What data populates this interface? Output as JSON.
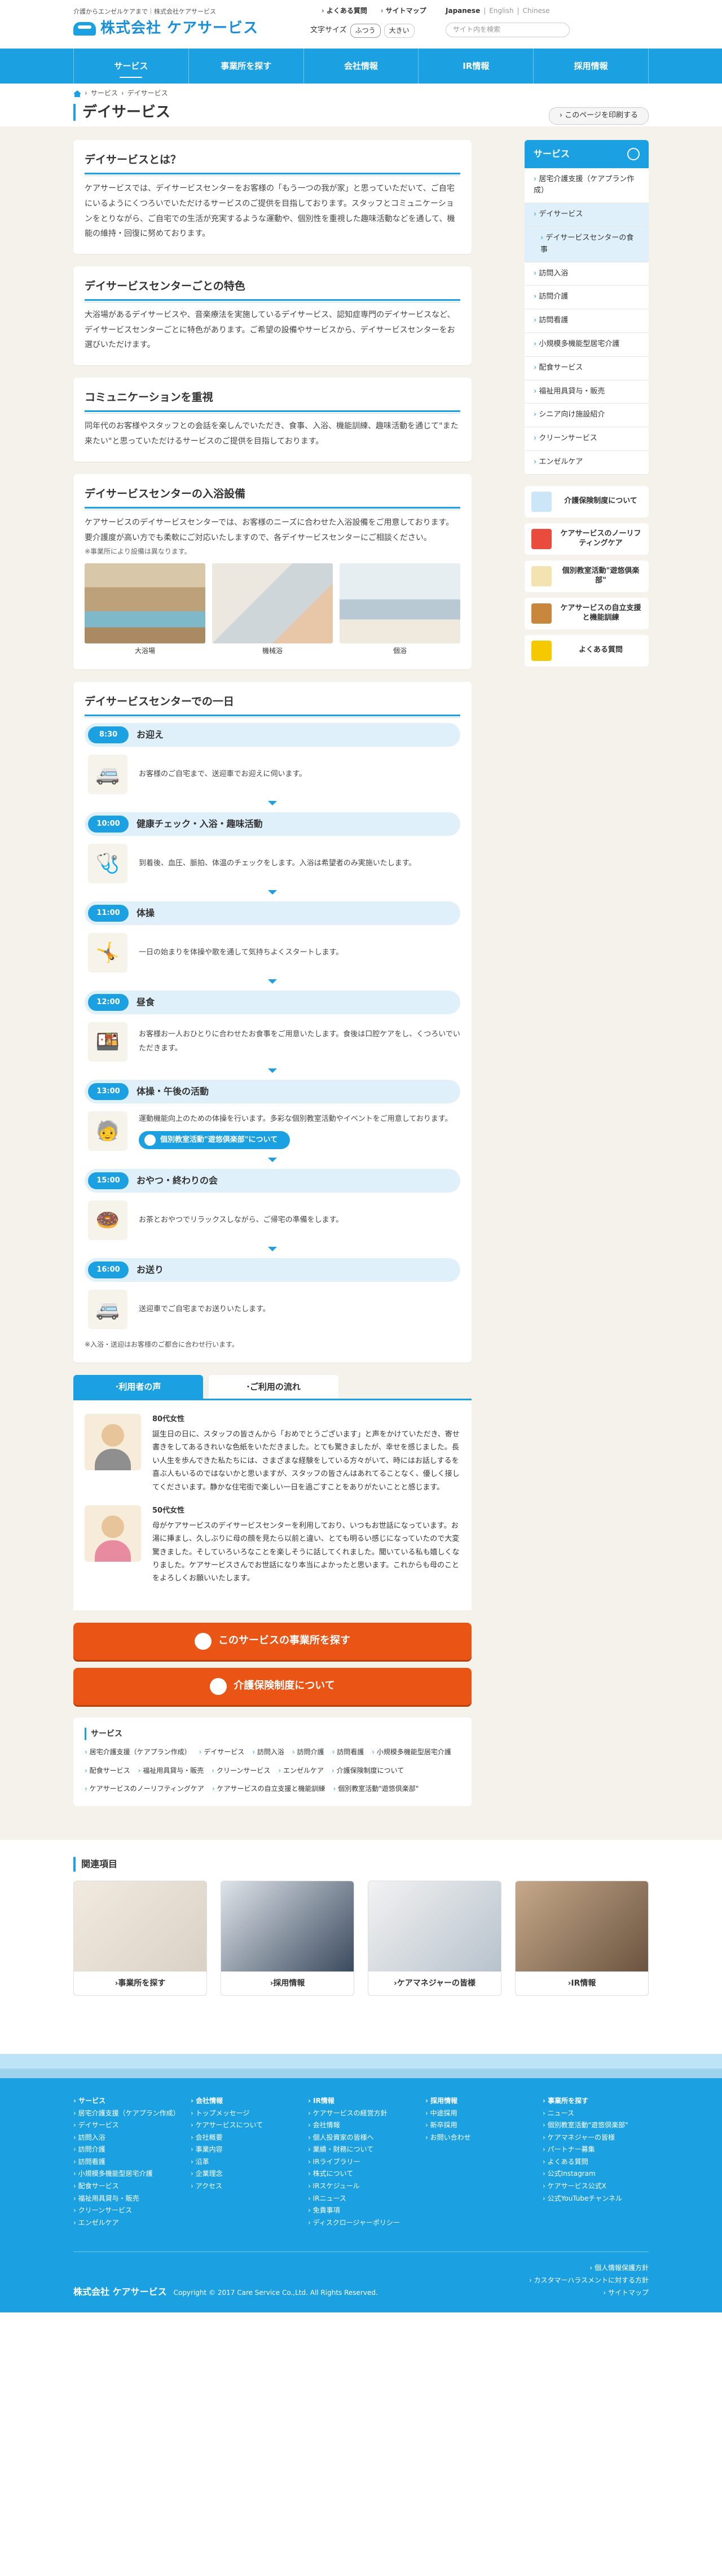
{
  "header": {
    "tagline": "介護からエンゼルケアまで｜株式会社ケアサービス",
    "logo": "株式会社 ケアサービス",
    "faq": "よくある質問",
    "sitemap": "サイトマップ",
    "langs": [
      "Japanese",
      "English",
      "Chinese"
    ],
    "fontsize_label": "文字サイズ",
    "fontsize_normal": "ふつう",
    "fontsize_large": "大きい",
    "search_placeholder": "サイト内を検索"
  },
  "gnav": [
    "サービス",
    "事業所を探す",
    "会社情報",
    "IR情報",
    "採用情報"
  ],
  "breadcrumb": [
    "サービス",
    "デイサービス"
  ],
  "page_title": "デイサービス",
  "print_label": "このページを印刷する",
  "sections": {
    "about": {
      "title": "デイサービスとは？",
      "text": "ケアサービスでは、デイサービスセンターをお客様の「もう一つの我が家」と思っていただいて、ご自宅にいるようにくつろいでいただけるサービスのご提供を目指しております。スタッフとコミュニケーションをとりながら、ご自宅での生活が充実するような運動や、個別性を重視した趣味活動などを通して、機能の維持・回復に努めております。"
    },
    "features": {
      "title": "デイサービスセンターごとの特色",
      "text": "大浴場があるデイサービスや、音楽療法を実施しているデイサービス、認知症専門のデイサービスなど、デイサービスセンターごとに特色があります。ご希望の設備やサービスから、デイサービスセンターをお選びいただけます。"
    },
    "communication": {
      "title": "コミュニケーションを重視",
      "text": "同年代のお客様やスタッフとの会話を楽しんでいただき、食事、入浴、機能訓練、趣味活動を通じて\"また来たい\"と思っていただけるサービスのご提供を目指しております。"
    },
    "bath": {
      "title": "デイサービスセンターの入浴設備",
      "text": "ケアサービスのデイサービスセンターでは、お客様のニーズに合わせた入浴設備をご用意しております。要介護度が高い方でも柔軟にご対応いたしますので、各デイサービスセンターにご相談ください。",
      "note": "※事業所により設備は異なります。",
      "photos": [
        "大浴場",
        "機械浴",
        "個浴"
      ]
    },
    "day": {
      "title": "デイサービスセンターでの一日",
      "steps": [
        {
          "time": "8:30",
          "title": "お迎え",
          "text": "お客様のご自宅まで、送迎車でお迎えに伺います。",
          "icon": "car-icon"
        },
        {
          "time": "10:00",
          "title": "健康チェック・入浴・趣味活動",
          "text": "到着後、血圧、脈拍、体温のチェックをします。入浴は希望者のみ実施いたします。",
          "icon": "stethoscope-icon"
        },
        {
          "time": "11:00",
          "title": "体操",
          "text": "一日の始まりを体操や歌を通して気持ちよくスタートします。",
          "icon": "exercise-icon"
        },
        {
          "time": "12:00",
          "title": "昼食",
          "text": "お客様お一人おひとりに合わせたお食事をご用意いたします。食後は口腔ケアをし、くつろいでいただきます。",
          "icon": "meal-icon"
        },
        {
          "time": "13:00",
          "title": "体操・午後の活動",
          "text": "運動機能向上のための体操を行います。多彩な個別教室活動やイベントをご用意しております。",
          "icon": "activity-icon",
          "button": "個別教室活動\"遊悠倶楽部\"について"
        },
        {
          "time": "15:00",
          "title": "おやつ・終わりの会",
          "text": "お茶とおやつでリラックスしながら、ご帰宅の準備をします。",
          "icon": "snack-icon"
        },
        {
          "time": "16:00",
          "title": "お送り",
          "text": "送迎車でご自宅までお送りいたします。",
          "icon": "car-icon"
        }
      ],
      "note": "※入浴・送迎はお客様のご都合に合わせ行います。"
    }
  },
  "tabs": [
    "利用者の声",
    "ご利用の流れ"
  ],
  "voices": [
    {
      "who": "80代女性",
      "text": "誕生日の日に、スタッフの皆さんから「おめでとうございます」と声をかけていただき、寄せ書きをしてあるきれいな色紙をいただきました。とても驚きましたが、幸せを感じました。長い人生を歩んできた私たちには、さまざまな経験をしている方々がいて、時にはお話しするを喜ぶ人もいるのではないかと思いますが、スタッフの皆さんはあれてることなく、優しく接してくださいます。静かな住宅街で楽しい一日を過ごすことをありがたいことと感じます。"
    },
    {
      "who": "50代女性",
      "text": "母がケアサービスのデイサービスセンターを利用しており、いつもお世話になっています。お湯に挿まし、久しぶりに母の顔を見たら以前と違い、とても明るい感じになっていたので大変驚きました。そしていろいろなことを楽しそうに話してくれました。聞いている私も嬉しくなりました。ケアサービスさんでお世話になり本当によかったと思います。これからも母のことをよろしくお願いいたします。"
    }
  ],
  "buttons": {
    "find": "このサービスの事業所を探す",
    "insurance": "介護保険制度について"
  },
  "service_links": {
    "title": "サービス",
    "items": [
      "居宅介護支援（ケアプラン作成）",
      "デイサービス",
      "訪問入浴",
      "訪問介護",
      "訪問看護",
      "小規模多機能型居宅介護",
      "配食サービス",
      "福祉用具貸与・販売",
      "クリーンサービス",
      "エンゼルケア",
      "介護保険制度について",
      "ケアサービスのノーリフティングケア",
      "ケアサービスの自立支援と機能訓練",
      "個別教室活動\"遊悠倶楽部\""
    ]
  },
  "side": {
    "title": "サービス",
    "items": [
      "居宅介護支援（ケアプラン作成）",
      "デイサービス",
      "デイサービスセンターの食事",
      "訪問入浴",
      "訪問介護",
      "訪問看護",
      "小規模多機能型居宅介護",
      "配食サービス",
      "福祉用具貸与・販売",
      "シニア向け施設紹介",
      "クリーンサービス",
      "エンゼルケア"
    ],
    "banners": [
      "介護保険制度について",
      "ケアサービスのノーリフティングケア",
      "個別教室活動\"遊悠倶楽部\"",
      "ケアサービスの自立支援と機能訓練",
      "よくある質問"
    ]
  },
  "related": {
    "title": "関連項目",
    "items": [
      "事業所を探す",
      "採用情報",
      "ケアマネジャーの皆様",
      "IR情報"
    ]
  },
  "footer": {
    "col1": [
      "サービス",
      "居宅介護支援（ケアプラン作成）",
      "デイサービス",
      "訪問入浴",
      "訪問介護",
      "訪問看護",
      "小規模多機能型居宅介護",
      "配食サービス",
      "福祉用具貸与・販売",
      "クリーンサービス",
      "エンゼルケア"
    ],
    "col2": [
      "会社情報",
      "トップメッセージ",
      "ケアサービスについて",
      "会社概要",
      "事業内容",
      "沿革",
      "企業理念",
      "アクセス"
    ],
    "col3": [
      "IR情報",
      "ケアサービスの経営方針",
      "会社情報",
      "個人投資家の皆様へ",
      "業績・財務について",
      "IRライブラリー",
      "株式について",
      "IRスケジュール",
      "IRニュース",
      "免責事項",
      "ディスクロージャーポリシー"
    ],
    "col4": [
      "採用情報",
      "中途採用",
      "新卒採用",
      "お問い合わせ"
    ],
    "col5": [
      "事業所を探す",
      "ニュース",
      "個別教室活動\"遊悠倶楽部\"",
      "ケアマネジャーの皆様",
      "パートナー募集",
      "よくある質問",
      "公式Instagram",
      "ケアサービス公式X",
      "公式YouTubeチャンネル"
    ],
    "logo": "株式会社 ケアサービス",
    "copyright": "Copyright © 2017 Care Service Co.,Ltd. All Rights Reserved.",
    "bottom_links": [
      "個人情報保護方針",
      "カスタマーハラスメントに対する方針",
      "サイトマップ"
    ]
  }
}
